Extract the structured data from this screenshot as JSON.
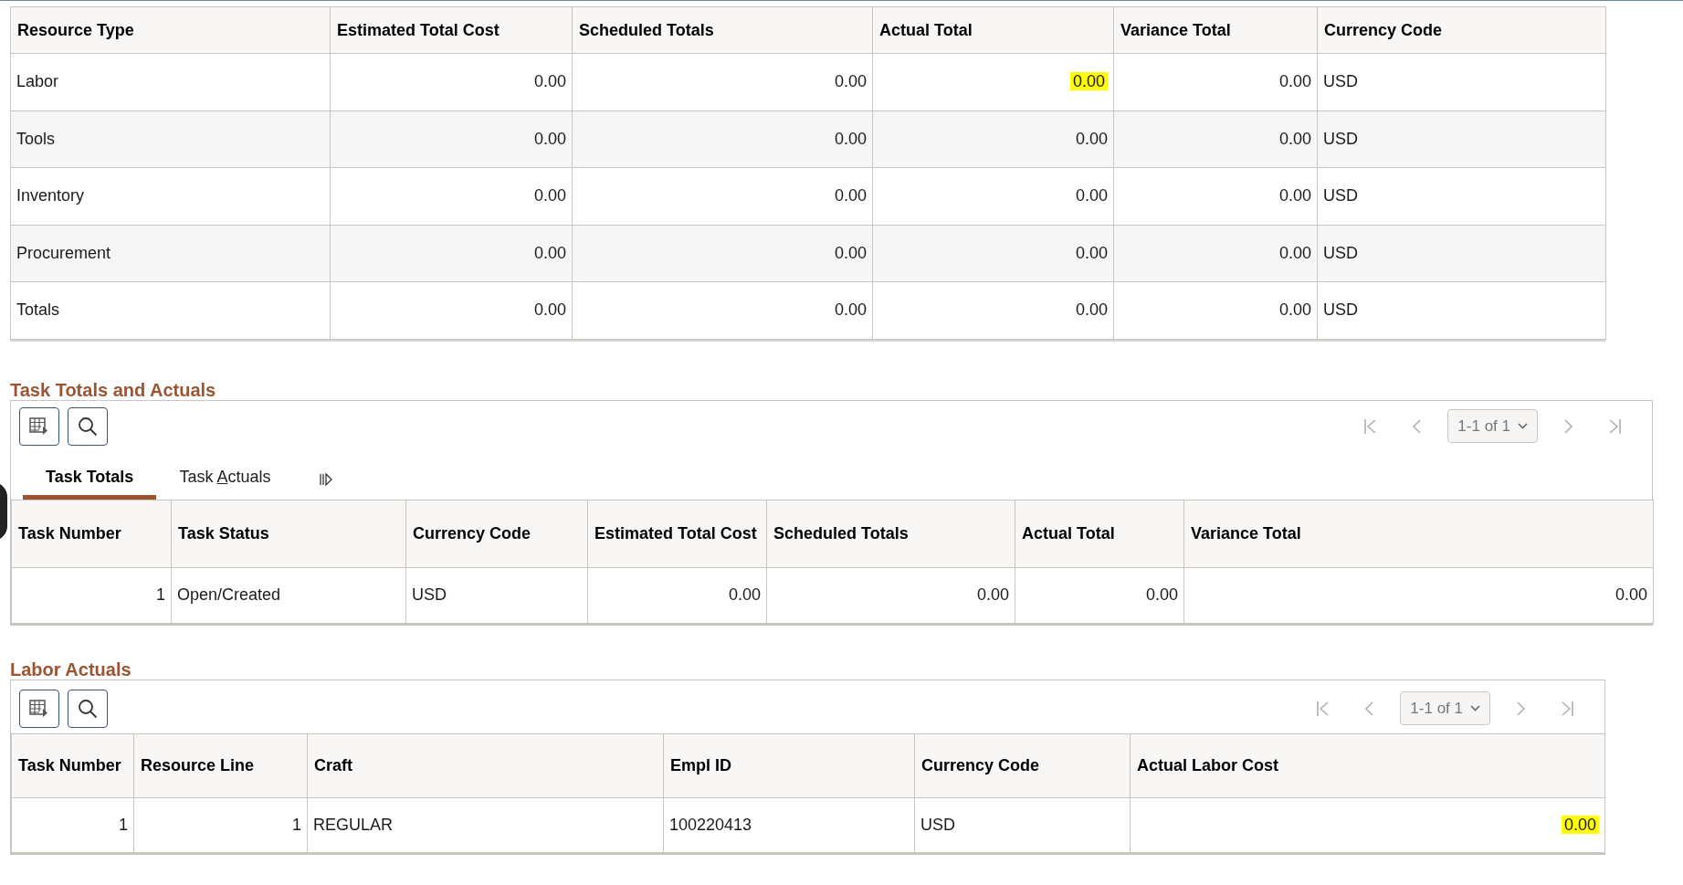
{
  "resource_table": {
    "columns": [
      {
        "label": "Resource Type",
        "kind": "text"
      },
      {
        "label": "Estimated Total Cost",
        "kind": "numeric"
      },
      {
        "label": "Scheduled Totals",
        "kind": "numeric"
      },
      {
        "label": "Actual Total",
        "kind": "numeric"
      },
      {
        "label": "Variance Total",
        "kind": "numeric"
      },
      {
        "label": "Currency Code",
        "kind": "text"
      }
    ],
    "rows": [
      {
        "cells": [
          {
            "text": "Labor",
            "highlighted": false
          },
          {
            "text": "0.00",
            "highlighted": false
          },
          {
            "text": "0.00",
            "highlighted": false
          },
          {
            "text": "0.00",
            "highlighted": true
          },
          {
            "text": "0.00",
            "highlighted": false
          },
          {
            "text": "USD",
            "highlighted": false
          }
        ]
      },
      {
        "cells": [
          {
            "text": "Tools",
            "highlighted": false
          },
          {
            "text": "0.00",
            "highlighted": false
          },
          {
            "text": "0.00",
            "highlighted": false
          },
          {
            "text": "0.00",
            "highlighted": false
          },
          {
            "text": "0.00",
            "highlighted": false
          },
          {
            "text": "USD",
            "highlighted": false
          }
        ]
      },
      {
        "cells": [
          {
            "text": "Inventory",
            "highlighted": false
          },
          {
            "text": "0.00",
            "highlighted": false
          },
          {
            "text": "0.00",
            "highlighted": false
          },
          {
            "text": "0.00",
            "highlighted": false
          },
          {
            "text": "0.00",
            "highlighted": false
          },
          {
            "text": "USD",
            "highlighted": false
          }
        ]
      },
      {
        "cells": [
          {
            "text": "Procurement",
            "highlighted": false
          },
          {
            "text": "0.00",
            "highlighted": false
          },
          {
            "text": "0.00",
            "highlighted": false
          },
          {
            "text": "0.00",
            "highlighted": false
          },
          {
            "text": "0.00",
            "highlighted": false
          },
          {
            "text": "USD",
            "highlighted": false
          }
        ]
      },
      {
        "cells": [
          {
            "text": "Totals",
            "highlighted": false
          },
          {
            "text": "0.00",
            "highlighted": false
          },
          {
            "text": "0.00",
            "highlighted": false
          },
          {
            "text": "0.00",
            "highlighted": false
          },
          {
            "text": "0.00",
            "highlighted": false
          },
          {
            "text": "USD",
            "highlighted": false
          }
        ]
      }
    ]
  },
  "task_section": {
    "title": "Task Totals and Actuals",
    "pager": {
      "range": "1-1 of 1",
      "nav_disabled": true
    },
    "tabs": [
      {
        "label": "Task Totals",
        "access_key_shown": false,
        "selected": true
      },
      {
        "label": "Task Actuals",
        "access_key_shown": true,
        "selected": false
      }
    ],
    "table": {
      "columns": [
        {
          "label": "Task Number",
          "kind": "numeric"
        },
        {
          "label": "Task Status",
          "kind": "text"
        },
        {
          "label": "Currency Code",
          "kind": "text"
        },
        {
          "label": "Estimated Total Cost",
          "kind": "numeric"
        },
        {
          "label": "Scheduled Totals",
          "kind": "numeric"
        },
        {
          "label": "Actual Total",
          "kind": "numeric"
        },
        {
          "label": "Variance Total",
          "kind": "numeric"
        }
      ],
      "rows": [
        {
          "cells": [
            {
              "text": "1",
              "highlighted": false
            },
            {
              "text": "Open/Created",
              "highlighted": false
            },
            {
              "text": "USD",
              "highlighted": false
            },
            {
              "text": "0.00",
              "highlighted": false
            },
            {
              "text": "0.00",
              "highlighted": false
            },
            {
              "text": "0.00",
              "highlighted": false
            },
            {
              "text": "0.00",
              "highlighted": false
            }
          ]
        }
      ]
    }
  },
  "labor_section": {
    "title": "Labor Actuals",
    "pager": {
      "range": "1-1 of 1",
      "nav_disabled": true
    },
    "table": {
      "columns": [
        {
          "label": "Task Number",
          "kind": "numeric"
        },
        {
          "label": "Resource Line",
          "kind": "numeric"
        },
        {
          "label": "Craft",
          "kind": "text"
        },
        {
          "label": "Empl ID",
          "kind": "text"
        },
        {
          "label": "Currency Code",
          "kind": "text"
        },
        {
          "label": "Actual Labor Cost",
          "kind": "numeric"
        }
      ],
      "rows": [
        {
          "cells": [
            {
              "text": "1",
              "highlighted": false
            },
            {
              "text": "1",
              "highlighted": false
            },
            {
              "text": "REGULAR",
              "highlighted": false
            },
            {
              "text": "100220413",
              "highlighted": false
            },
            {
              "text": "USD",
              "highlighted": false
            },
            {
              "text": "0.00",
              "highlighted": true
            }
          ]
        }
      ]
    }
  }
}
